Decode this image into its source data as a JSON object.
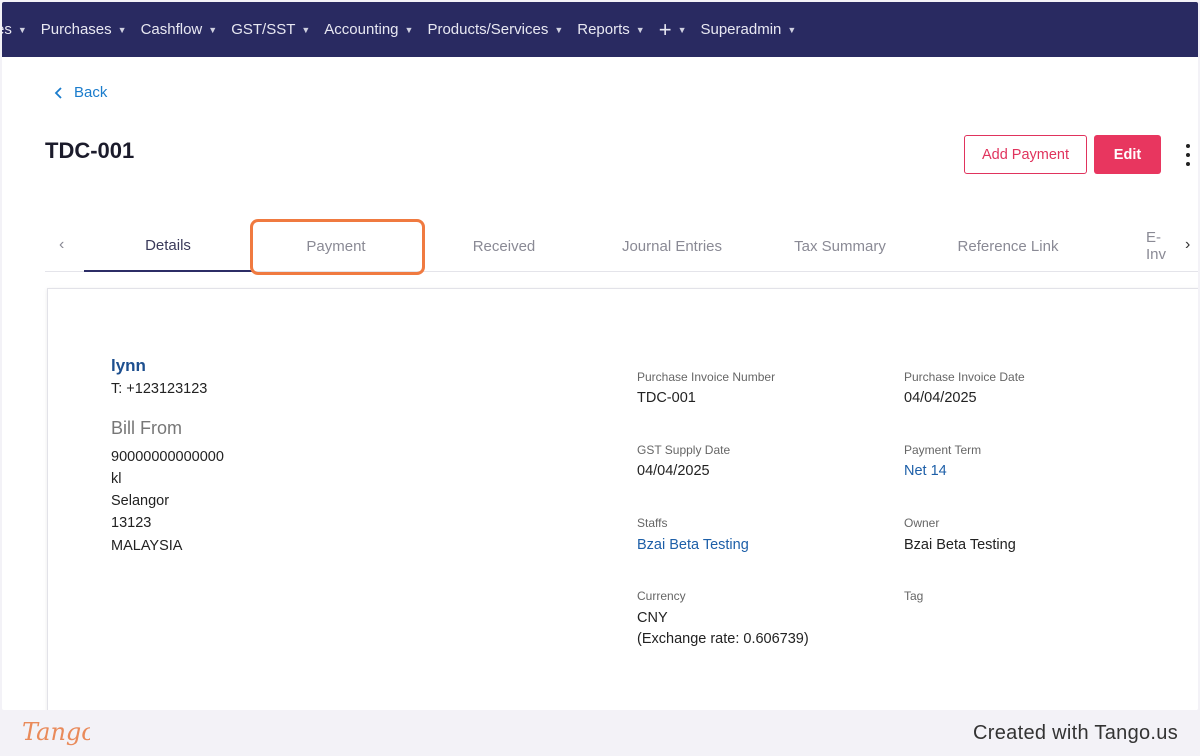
{
  "nav": {
    "items": [
      {
        "label": "es"
      },
      {
        "label": "Purchases"
      },
      {
        "label": "Cashflow"
      },
      {
        "label": "GST/SST"
      },
      {
        "label": "Accounting"
      },
      {
        "label": "Products/Services"
      },
      {
        "label": "Reports"
      }
    ],
    "plus_label": "+",
    "user_label": "Superadmin"
  },
  "back_label": "Back",
  "title": "TDC-001",
  "actions": {
    "add_payment": "Add Payment",
    "edit": "Edit"
  },
  "tabs": [
    {
      "label": "Details",
      "active": true
    },
    {
      "label": "Payment",
      "active": false
    },
    {
      "label": "Received",
      "active": false
    },
    {
      "label": "Journal Entries",
      "active": false
    },
    {
      "label": "Tax Summary",
      "active": false
    },
    {
      "label": "Reference Link",
      "active": false
    },
    {
      "label": "E-Inv",
      "active": false
    }
  ],
  "vendor": {
    "name": "lynn",
    "phone": "T: +123123123",
    "bill_from_heading": "Bill From",
    "address": [
      "90000000000000",
      "kl",
      "Selangor",
      "13123",
      "MALAYSIA"
    ]
  },
  "fields": {
    "invoice_number": {
      "label": "Purchase Invoice Number",
      "value": "TDC-001"
    },
    "invoice_date": {
      "label": "Purchase Invoice Date",
      "value": "04/04/2025"
    },
    "supply_date": {
      "label": "GST Supply Date",
      "value": "04/04/2025"
    },
    "payment_term": {
      "label": "Payment Term",
      "value": "Net 14"
    },
    "staffs": {
      "label": "Staffs",
      "value": "Bzai Beta Testing"
    },
    "owner": {
      "label": "Owner",
      "value": "Bzai Beta Testing"
    },
    "currency": {
      "label": "Currency",
      "value": "CNY",
      "rate": "(Exchange rate: 0.606739)"
    },
    "tag": {
      "label": "Tag",
      "value": ""
    }
  },
  "footer": {
    "brand": "Tango",
    "credit": "Created with Tango.us"
  },
  "colors": {
    "nav_bg": "#292a61",
    "accent": "#e8365f",
    "link": "#1a7ccc",
    "highlight": "#f07a40"
  }
}
